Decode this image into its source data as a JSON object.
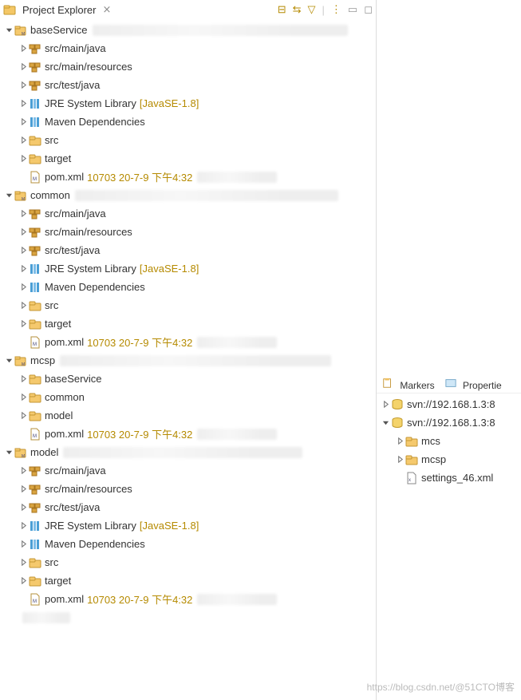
{
  "view": {
    "title": "Project Explorer"
  },
  "toolbarIcons": [
    "collapse",
    "link",
    "filter",
    "menu",
    "min",
    "max"
  ],
  "projects": [
    {
      "name": "baseService",
      "expanded": true,
      "blurW": 320,
      "children": [
        {
          "kind": "pkgroot",
          "label": "src/main/java"
        },
        {
          "kind": "pkgroot",
          "label": "src/main/resources"
        },
        {
          "kind": "pkgroot",
          "label": "src/test/java"
        },
        {
          "kind": "library",
          "label": "JRE System Library",
          "decor": "[JavaSE-1.8]"
        },
        {
          "kind": "library",
          "label": "Maven Dependencies"
        },
        {
          "kind": "folder",
          "label": "src"
        },
        {
          "kind": "folder",
          "label": "target"
        },
        {
          "kind": "file",
          "label": "pom.xml",
          "decor": "10703  20-7-9 下午4:32",
          "blurW": 100
        }
      ]
    },
    {
      "name": "common",
      "expanded": true,
      "blurW": 330,
      "children": [
        {
          "kind": "pkgroot",
          "label": "src/main/java"
        },
        {
          "kind": "pkgroot",
          "label": "src/main/resources"
        },
        {
          "kind": "pkgroot",
          "label": "src/test/java"
        },
        {
          "kind": "library",
          "label": "JRE System Library",
          "decor": "[JavaSE-1.8]"
        },
        {
          "kind": "library",
          "label": "Maven Dependencies"
        },
        {
          "kind": "folder",
          "label": "src"
        },
        {
          "kind": "folder",
          "label": "target"
        },
        {
          "kind": "file",
          "label": "pom.xml",
          "decor": "10703  20-7-9 下午4:32",
          "blurW": 100
        }
      ]
    },
    {
      "name": "mcsp",
      "expanded": true,
      "blurW": 340,
      "children": [
        {
          "kind": "folder",
          "label": "baseService"
        },
        {
          "kind": "folder",
          "label": "common"
        },
        {
          "kind": "folder",
          "label": "model"
        },
        {
          "kind": "file",
          "label": "pom.xml",
          "decor": "10703  20-7-9 下午4:32",
          "blurW": 100
        }
      ]
    },
    {
      "name": "model",
      "expanded": true,
      "blurW": 300,
      "children": [
        {
          "kind": "pkgroot",
          "label": "src/main/java"
        },
        {
          "kind": "pkgroot",
          "label": "src/main/resources"
        },
        {
          "kind": "pkgroot",
          "label": "src/test/java"
        },
        {
          "kind": "library",
          "label": "JRE System Library",
          "decor": "[JavaSE-1.8]"
        },
        {
          "kind": "library",
          "label": "Maven Dependencies"
        },
        {
          "kind": "folder",
          "label": "src"
        },
        {
          "kind": "folder",
          "label": "target"
        },
        {
          "kind": "file",
          "label": "pom.xml",
          "decor": "10703  20-7-9 下午4:32",
          "blurW": 100
        }
      ]
    }
  ],
  "rightTabs": [
    "Markers",
    "Propertie"
  ],
  "repos": [
    {
      "label": "svn://192.168.1.3:8",
      "expanded": false
    },
    {
      "label": "svn://192.168.1.3:8",
      "expanded": true,
      "children": [
        {
          "kind": "folder",
          "label": "mcs"
        },
        {
          "kind": "folder",
          "label": "mcsp"
        },
        {
          "kind": "xml",
          "label": "settings_46.xml"
        }
      ]
    }
  ],
  "watermark": "https://blog.csdn.net/@51CTO博客"
}
